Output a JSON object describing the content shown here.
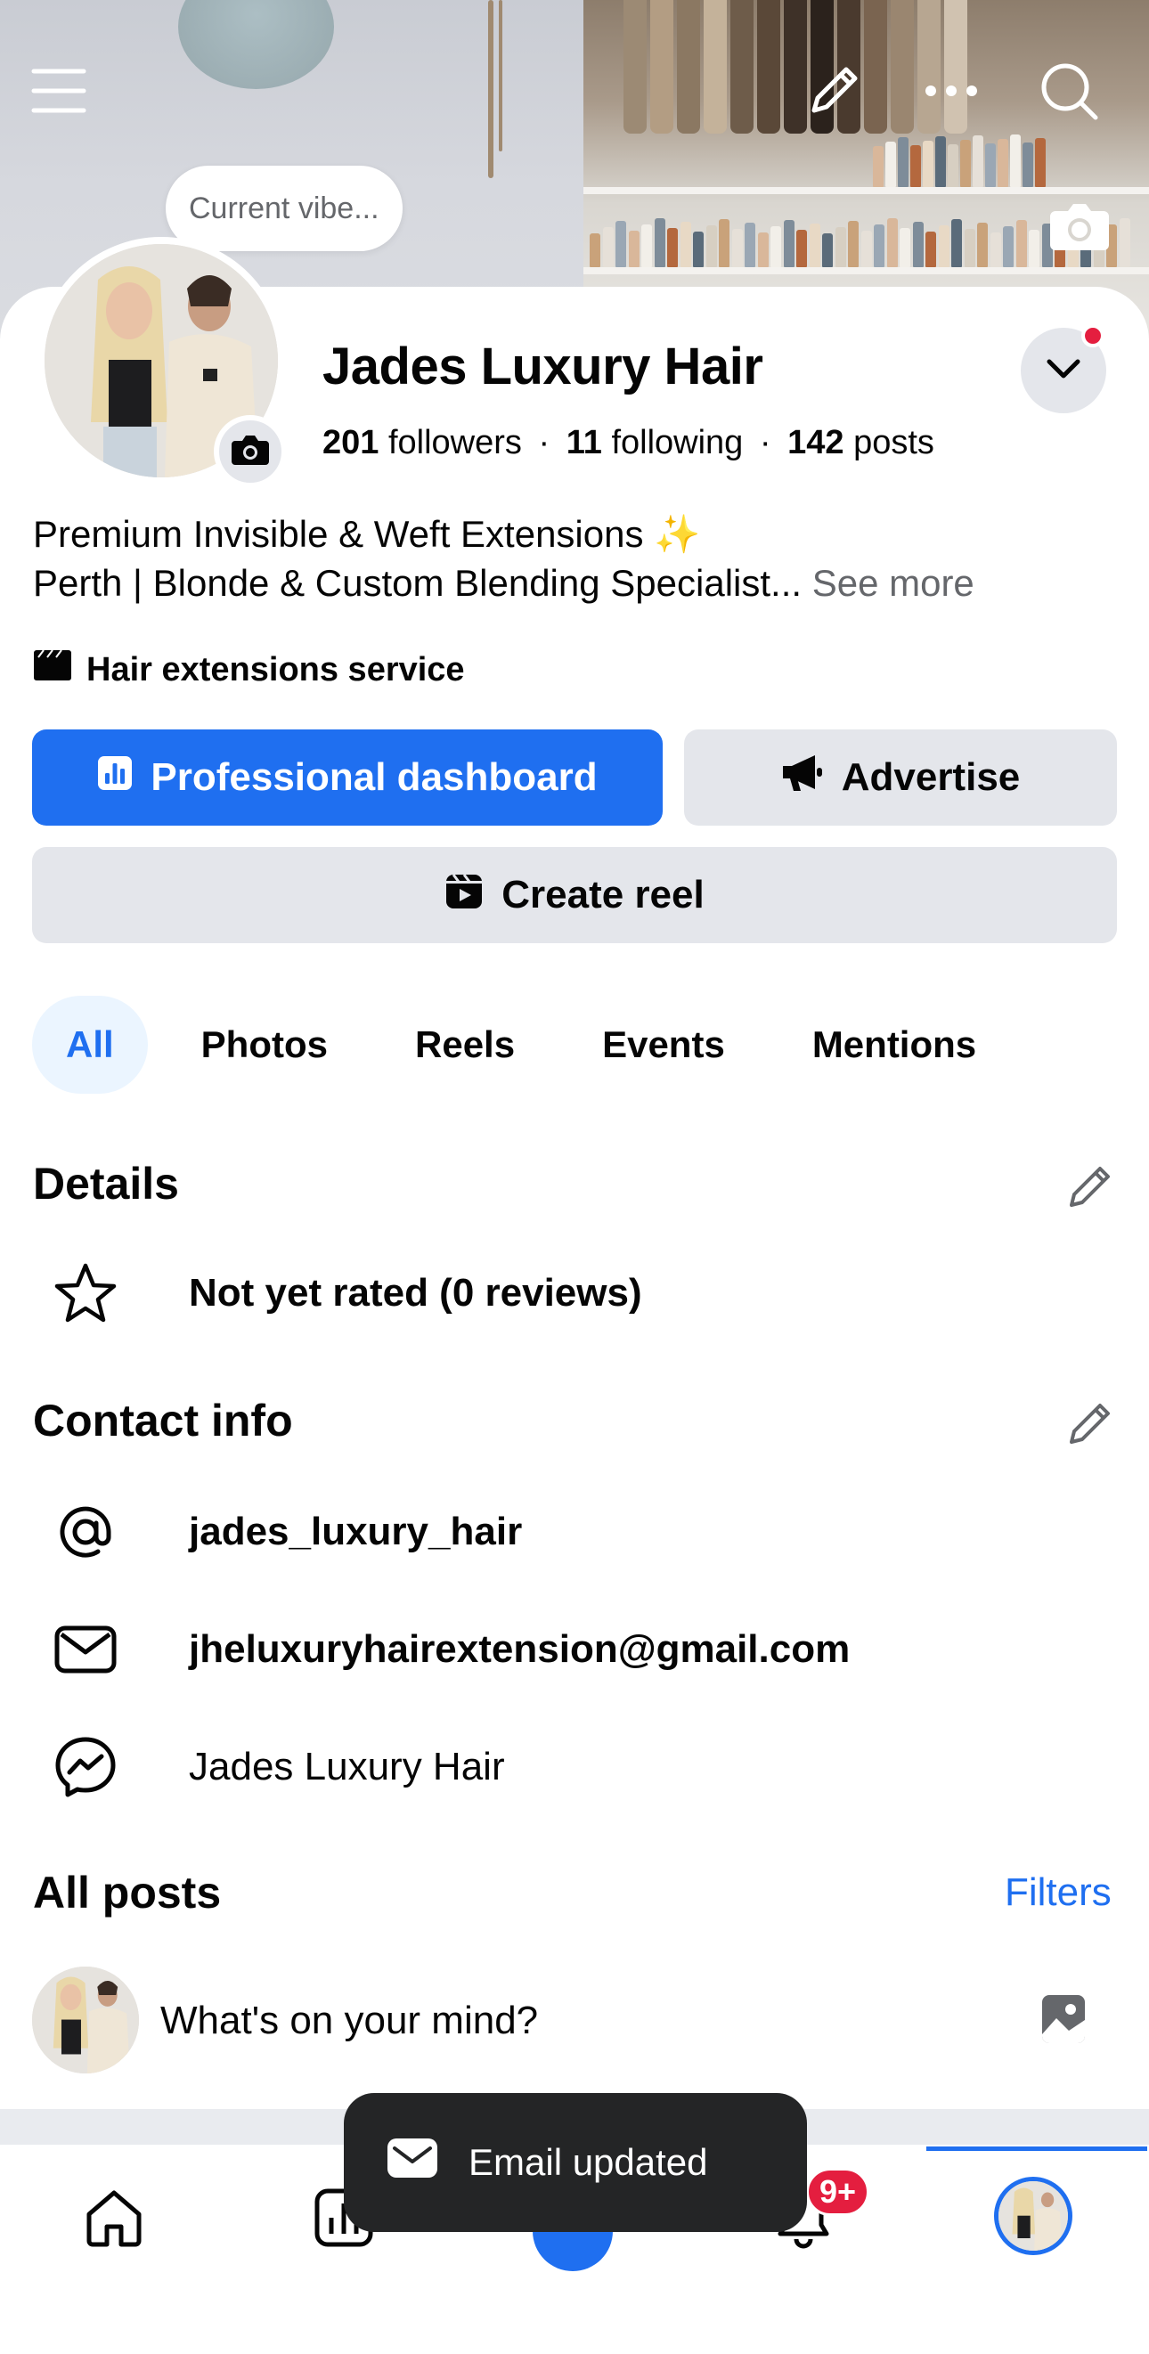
{
  "header": {
    "menu_icon": "hamburger-menu-icon",
    "edit_icon": "pencil-icon",
    "more_icon": "more-dots-icon",
    "search_icon": "search-icon",
    "cover_camera_icon": "camera-icon"
  },
  "profile": {
    "status_bubble": "Current vibe...",
    "name": "Jades Luxury Hair",
    "followers_count": "201",
    "followers_label": "followers",
    "following_count": "11",
    "following_label": "following",
    "posts_count": "142",
    "posts_label": "posts",
    "separator": "·",
    "bio_line1": "Premium Invisible & Weft Extensions ✨",
    "bio_line2": "Perth | Blonde & Custom Blending Specialist...",
    "see_more": "See more",
    "category": "Hair extensions service"
  },
  "actions": {
    "dashboard": "Professional dashboard",
    "advertise": "Advertise",
    "create_reel": "Create reel"
  },
  "tabs": [
    {
      "label": "All",
      "active": true
    },
    {
      "label": "Photos",
      "active": false
    },
    {
      "label": "Reels",
      "active": false
    },
    {
      "label": "Events",
      "active": false
    },
    {
      "label": "Mentions",
      "active": false
    }
  ],
  "details": {
    "title": "Details",
    "rating": "Not yet rated (0 reviews)"
  },
  "contact": {
    "title": "Contact info",
    "instagram": "jades_luxury_hair",
    "email": "jheluxuryhairextension@gmail.com",
    "messenger": "Jades Luxury Hair"
  },
  "posts": {
    "title": "All posts",
    "filters": "Filters",
    "composer_placeholder": "What's on your mind?"
  },
  "toast": {
    "text": "Email updated"
  },
  "nav": {
    "notifications_badge": "9+"
  },
  "colors": {
    "accent": "#1f6ff0",
    "badge": "#e41e3f",
    "button_gray": "#e4e6eb",
    "toast_bg": "#242526"
  }
}
